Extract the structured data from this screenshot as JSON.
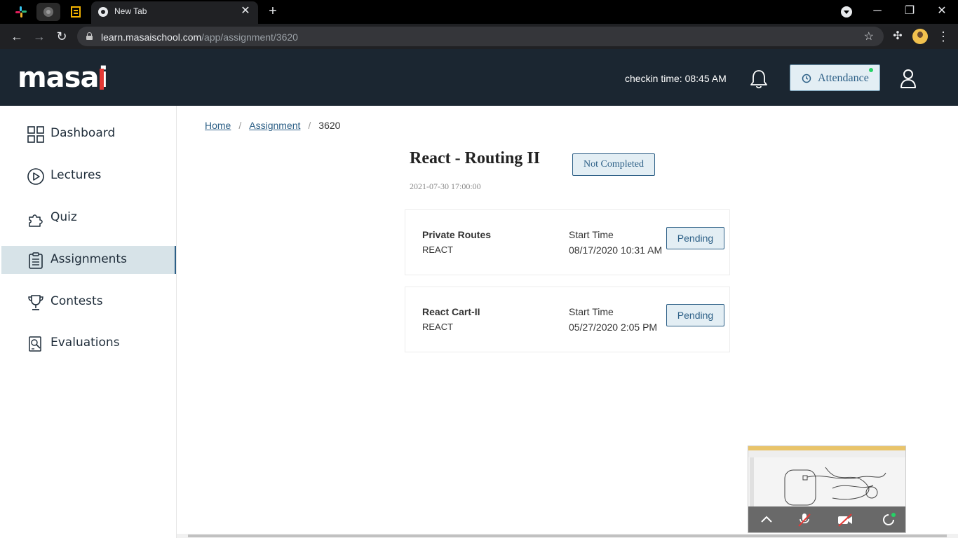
{
  "browser": {
    "tab_title": "New Tab",
    "url_host": "learn.masaischool.com",
    "url_path": "/app/assignment/3620",
    "colors": {
      "chrome_bg": "#000000",
      "toolbar_bg": "#202124"
    }
  },
  "header": {
    "logo": "masai",
    "checkin_text": "checkin time: 08:45 AM",
    "attendance_label": "Attendance",
    "colors": {
      "bg": "#1b2631",
      "accent": "#e53935"
    }
  },
  "sidebar": {
    "items": [
      {
        "label": "Dashboard",
        "icon": "grid-icon"
      },
      {
        "label": "Lectures",
        "icon": "play-circle-icon"
      },
      {
        "label": "Quiz",
        "icon": "puzzle-icon"
      },
      {
        "label": "Assignments",
        "icon": "clipboard-icon",
        "active": true
      },
      {
        "label": "Contests",
        "icon": "trophy-icon"
      },
      {
        "label": "Evaluations",
        "icon": "evaluation-icon"
      }
    ]
  },
  "breadcrumb": {
    "home": "Home",
    "assignment": "Assignment",
    "current": "3620",
    "separator": "/"
  },
  "assignment": {
    "title": "React - Routing II",
    "status": "Not Completed",
    "deadline": "2021-07-30 17:00:00",
    "problems": [
      {
        "name": "Private Routes",
        "tag": "REACT",
        "start_label": "Start Time",
        "start_time": "08/17/2020 10:31 AM",
        "status": "Pending"
      },
      {
        "name": "React Cart-II",
        "tag": "REACT",
        "start_label": "Start Time",
        "start_time": "05/27/2020 2:05 PM",
        "status": "Pending"
      }
    ]
  }
}
